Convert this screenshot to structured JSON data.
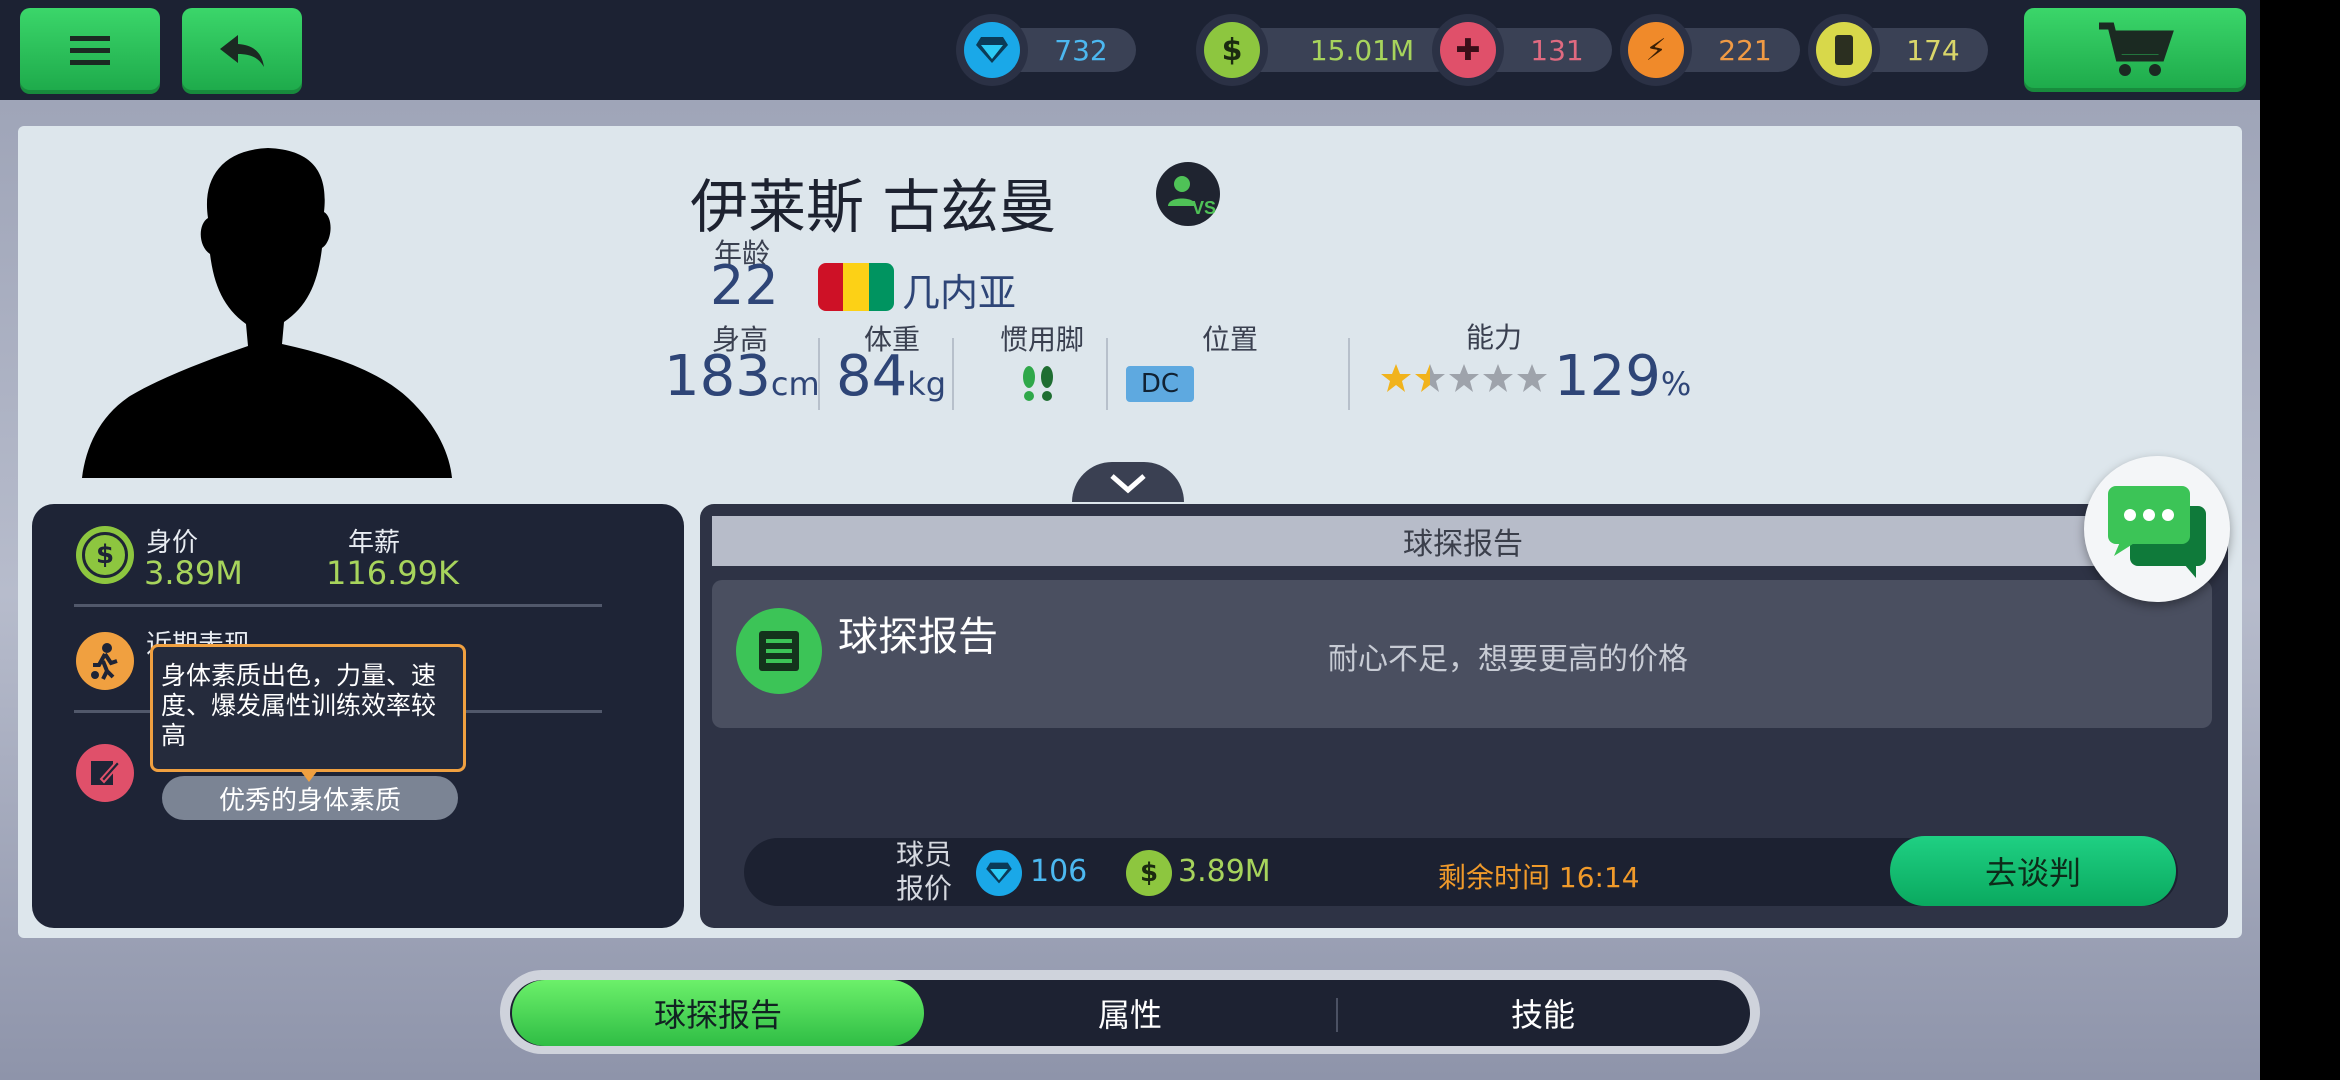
{
  "topbar": {
    "resources": [
      {
        "name": "diamond",
        "icon": "diamond-icon",
        "value": "732",
        "color": "#1aa8e8",
        "text_color": "#4cb8f0"
      },
      {
        "name": "cash",
        "icon": "dollar-icon",
        "value": "15.01M",
        "color": "#8dc63f",
        "text_color": "#a7d45c"
      },
      {
        "name": "medical",
        "icon": "medkit-icon",
        "value": "131",
        "color": "#e0506a",
        "text_color": "#e06a80"
      },
      {
        "name": "energy",
        "icon": "lightning-icon",
        "value": "221",
        "color": "#f08a2a",
        "text_color": "#f09a44"
      },
      {
        "name": "cards",
        "icon": "card-icon",
        "value": "174",
        "color": "#d8d84a",
        "text_color": "#d9d66a"
      }
    ]
  },
  "player": {
    "name": "伊莱斯 古兹曼",
    "age_label": "年龄",
    "age": "22",
    "country": "几内亚",
    "flag_colors": [
      "#ce1126",
      "#fcd116",
      "#009460"
    ],
    "height_label": "身高",
    "height": "183",
    "height_unit": "cm",
    "weight_label": "体重",
    "weight": "84",
    "weight_unit": "kg",
    "foot_label": "惯用脚",
    "position_label": "位置",
    "position": "DC",
    "ability_label": "能力",
    "ability": "129",
    "ability_unit": "%",
    "stars_filled": 1.5,
    "stars_total": 5
  },
  "left": {
    "value_label": "身价",
    "value": "3.89M",
    "salary_label": "年薪",
    "salary": "116.99K",
    "recent_label": "近期表现",
    "tooltip": "身体素质出色，力量、速度、爆发属性训练效率较高",
    "trait_tag": "优秀的身体素质"
  },
  "scout": {
    "header": "球探报告",
    "title": "球探报告",
    "comment": "耐心不足，想要更高的价格"
  },
  "offer": {
    "label_line1": "球员",
    "label_line2": "报价",
    "diamond_value": "106",
    "cash_value": "3.89M",
    "time_label": "剩余时间 16:14",
    "negotiate_label": "去谈判"
  },
  "tabs": [
    {
      "label": "球探报告",
      "active": true
    },
    {
      "label": "属性",
      "active": false
    },
    {
      "label": "技能",
      "active": false
    }
  ]
}
